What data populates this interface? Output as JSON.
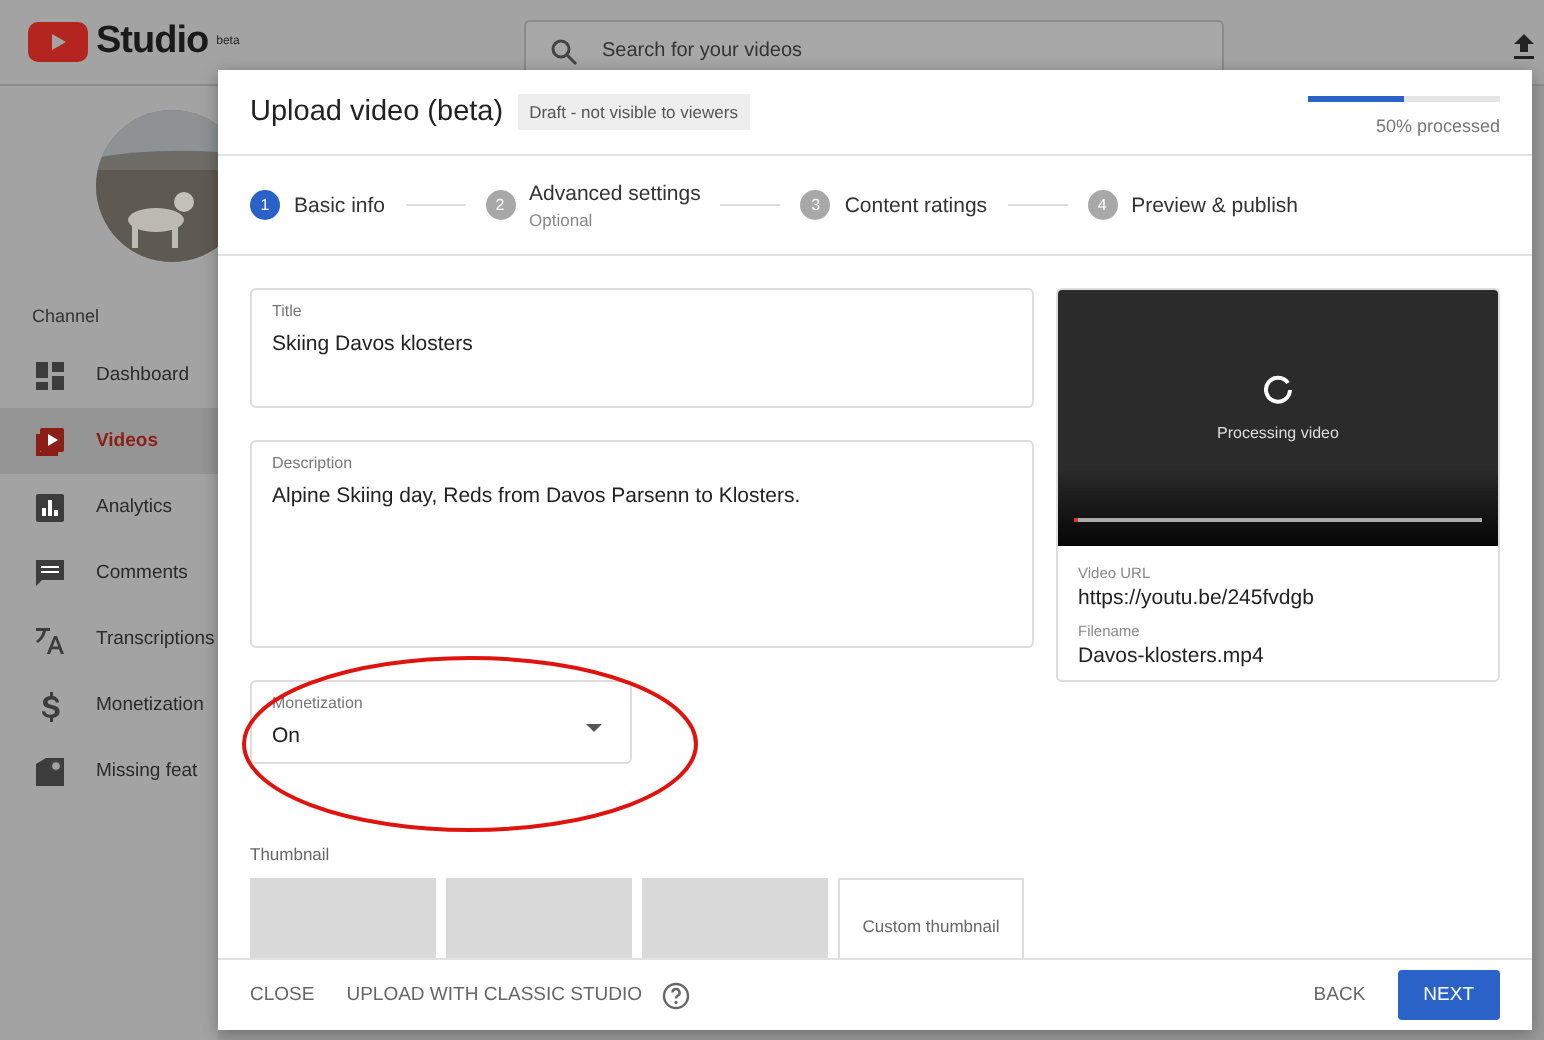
{
  "app": {
    "logo": "Studio",
    "logo_badge": "beta"
  },
  "search": {
    "placeholder": "Search for your videos"
  },
  "sidebar": {
    "section": "Channel",
    "items": [
      {
        "label": "Dashboard",
        "selected": false
      },
      {
        "label": "Videos",
        "selected": true
      },
      {
        "label": "Analytics",
        "selected": false
      },
      {
        "label": "Comments",
        "selected": false
      },
      {
        "label": "Transcriptions",
        "selected": false
      },
      {
        "label": "Monetization",
        "selected": false
      },
      {
        "label": "Missing feat",
        "selected": false
      }
    ]
  },
  "dialog": {
    "title": "Upload video (beta)",
    "status": "Draft - not visible to viewers",
    "progress": {
      "level": 0.5,
      "label": "50% processed"
    },
    "steps": [
      {
        "number": "1",
        "label": "Basic info",
        "selected": true
      },
      {
        "number": "2",
        "label": "Advanced settings",
        "sublabel": "Optional",
        "selected": false
      },
      {
        "number": "3",
        "label": "Content ratings",
        "selected": false
      },
      {
        "number": "4",
        "label": "Preview & publish",
        "selected": false
      }
    ],
    "title_field": {
      "label": "Title",
      "value": "Skiing Davos klosters"
    },
    "description_field": {
      "label": "Description",
      "value": "Alpine Skiing day, Reds from Davos Parsenn to Klosters."
    },
    "monetization_field": {
      "label": "Monetization",
      "value": "On"
    },
    "thumbnail": {
      "label": "Thumbnail",
      "custom": "Custom thumbnail"
    },
    "preview": {
      "status": "Processing video",
      "level": 0.01,
      "url_label": "Video URL",
      "url": "https://youtu.be/245fvdgb",
      "filename_label": "Filename",
      "filename": "Davos-klosters.mp4"
    },
    "footer": {
      "close": "CLOSE",
      "classic": "UPLOAD WITH CLASSIC STUDIO",
      "back": "BACK",
      "next": "NEXT"
    }
  }
}
